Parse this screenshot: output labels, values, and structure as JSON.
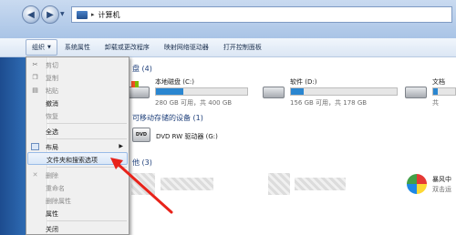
{
  "address": {
    "separator": "▸",
    "location": "计算机"
  },
  "toolbar": {
    "organize": "组织",
    "items": [
      "系统属性",
      "卸载或更改程序",
      "映射网络驱动器",
      "打开控制面板"
    ]
  },
  "sections": {
    "hard_disks": "盘 (4)",
    "removable": "可移动存储的设备 (1)",
    "other": "他 (3)"
  },
  "drives": [
    {
      "name": "本地磁盘 (C:)",
      "free": "280 GB 可用，共 400 GB",
      "used_fraction": 0.3
    },
    {
      "name": "软件 (D:)",
      "free": "156 GB 可用，共 178 GB",
      "used_fraction": 0.12
    },
    {
      "name": "文档",
      "free": "共",
      "used_fraction": 0.2
    }
  ],
  "dvd": {
    "badge": "DVD",
    "name": "DVD RW 驱动器 (G:)"
  },
  "other_items": [
    {
      "name": "暴风中",
      "sub": "双击运"
    }
  ],
  "menu": {
    "items": [
      {
        "label": "剪切",
        "disabled": true,
        "icon": "cut-icon"
      },
      {
        "label": "复制",
        "disabled": true,
        "icon": "copy-icon"
      },
      {
        "label": "粘贴",
        "disabled": true,
        "icon": "paste-icon"
      },
      {
        "label": "撤消",
        "disabled": false,
        "icon": ""
      },
      {
        "label": "恢复",
        "disabled": true,
        "icon": ""
      },
      {
        "label": "全选",
        "disabled": false,
        "icon": ""
      },
      {
        "label": "布局",
        "disabled": false,
        "icon": "layout-icon",
        "submenu": true
      },
      {
        "label": "文件夹和搜索选项",
        "disabled": false,
        "icon": "",
        "highlighted": true
      },
      {
        "label": "删除",
        "disabled": true,
        "icon": "delete-icon"
      },
      {
        "label": "重命名",
        "disabled": true,
        "icon": ""
      },
      {
        "label": "删除属性",
        "disabled": true,
        "icon": ""
      },
      {
        "label": "属性",
        "disabled": false,
        "icon": ""
      },
      {
        "label": "关闭",
        "disabled": false,
        "icon": ""
      }
    ]
  },
  "colors": {
    "annotation_arrow": "#e8231a",
    "drive_bar": "#2a86d0"
  }
}
